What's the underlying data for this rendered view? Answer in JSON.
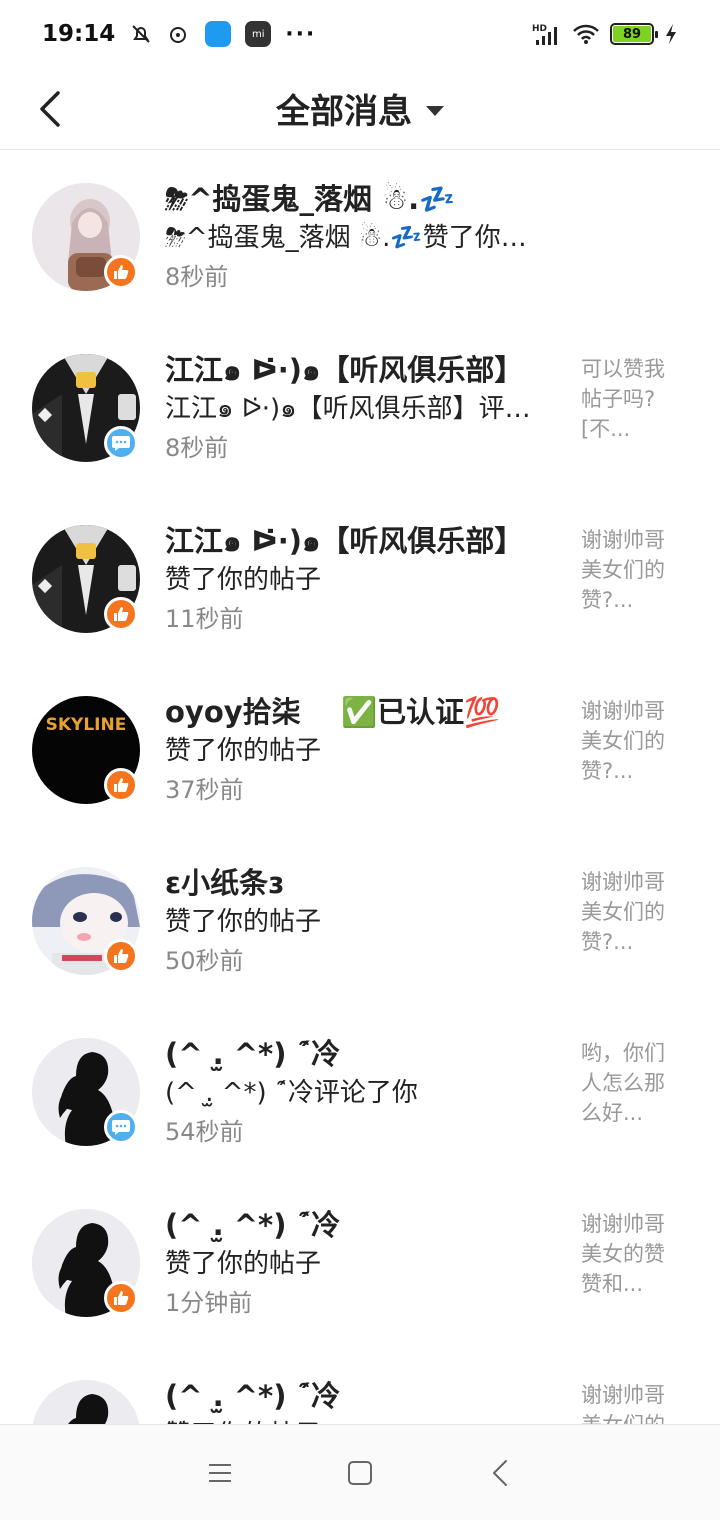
{
  "status_bar": {
    "time": "19:14",
    "battery": "89",
    "icons": [
      "bell-off-icon",
      "music-icon",
      "app-chip-blue",
      "app-chip-mi",
      "more-dots",
      "hd-signal-icon",
      "wifi-icon",
      "battery-icon",
      "charging-icon"
    ],
    "hd_label": "HD",
    "mi_label": "mi",
    "dots": "···"
  },
  "header": {
    "title": "全部消息",
    "back_icon": "chevron-left-icon",
    "dropdown_icon": "caret-down-icon"
  },
  "messages": [
    {
      "name": "⛈^捣蛋鬼_落烟 ☃.💤",
      "action": "⛈^捣蛋鬼_落烟 ☃.💤赞了你…",
      "time": "8秒前",
      "badge": "like",
      "preview": [
        "",
        "",
        ""
      ],
      "avatar": "anime-girl-avatar"
    },
    {
      "name": "江江๑ ᐅ̇·)๑【听风俱乐部】",
      "action": "江江๑ ᐅ̇·)๑【听风俱乐部】评…",
      "time": "8秒前",
      "badge": "comment",
      "preview": [
        "可以赞我",
        "帖子吗?",
        "[不..."
      ],
      "avatar": "dark-suit-avatar"
    },
    {
      "name": "江江๑ ᐅ̇·)๑【听风俱乐部】",
      "action": "赞了你的帖子",
      "time": "11秒前",
      "badge": "like",
      "preview": [
        "谢谢帅哥",
        "美女们的",
        "赞?..."
      ],
      "avatar": "dark-suit-avatar"
    },
    {
      "name": "oyoy拾柒    ✅已认证💯",
      "action": "赞了你的帖子",
      "time": "37秒前",
      "badge": "like",
      "preview": [
        "谢谢帅哥",
        "美女们的",
        "赞?..."
      ],
      "avatar": "skyline-avatar",
      "avatar_text": "SKYLINE"
    },
    {
      "name": "ɛ小纸条ɜ",
      "action": "赞了你的帖子",
      "time": "50秒前",
      "badge": "like",
      "preview": [
        "谢谢帅哥",
        "美女们的",
        "赞?..."
      ],
      "avatar": "anime-face-avatar"
    },
    {
      "name": "(^ .̫ ^*) ˊ̑冷",
      "action": "(^ .̫ ^*) ˊ̑冷评论了你",
      "time": "54秒前",
      "badge": "comment",
      "preview": [
        "哟，你们",
        "人怎么那",
        "么好..."
      ],
      "avatar": "silhouette-avatar"
    },
    {
      "name": "(^ .̫ ^*) ˊ̑冷",
      "action": "赞了你的帖子",
      "time": "1分钟前",
      "badge": "like",
      "preview": [
        "谢谢帅哥",
        "美女的赞",
        "赞和..."
      ],
      "avatar": "silhouette-avatar"
    },
    {
      "name": "(^ .̫ ^*) ˊ̑冷",
      "action": "赞了你的帖子",
      "time": "",
      "badge": "like",
      "preview": [
        "谢谢帅哥",
        "美女们的",
        ""
      ],
      "avatar": "silhouette-avatar"
    }
  ],
  "nav_bar": {
    "icons": [
      "menu-icon",
      "home-square-icon",
      "back-triangle-icon"
    ]
  },
  "colors": {
    "like_badge": "#f5741e",
    "comment_badge": "#4fb0f0",
    "battery_fill": "#7ed321",
    "time_text": "#888888",
    "preview_text": "#999999"
  }
}
